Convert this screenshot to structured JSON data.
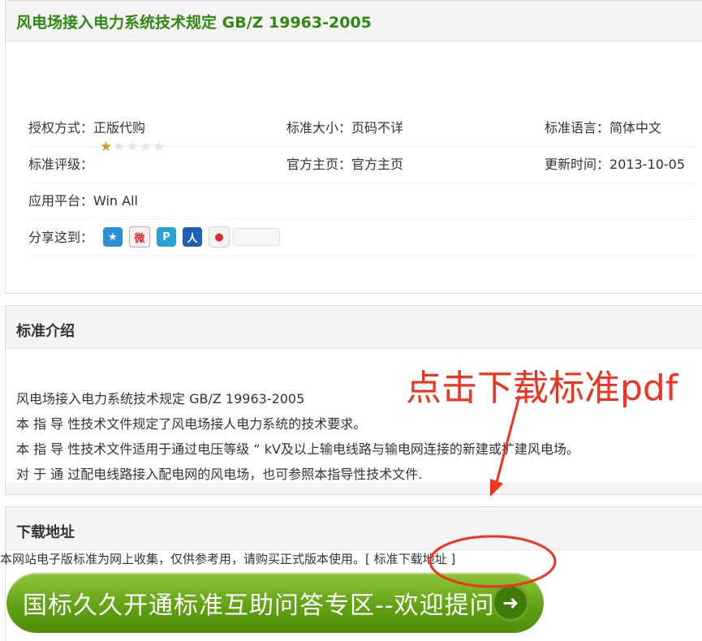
{
  "page_title": "风电场接入电力系统技术规定 GB/Z 19963-2005",
  "info": {
    "auth_label": "授权方式：",
    "auth_value": "正版代购",
    "size_label": "标准大小：",
    "size_value": "页码不详",
    "lang_label": "标准语言：",
    "lang_value": "简体中文",
    "rating_label": "标准评级：",
    "rating_stars": 1,
    "rating_max": 5,
    "homepage_label": "官方主页：",
    "homepage_value": "官方主页",
    "updated_label": "更新时间：",
    "updated_value": "2013-10-05",
    "platform_label": "应用平台：",
    "platform_value": "Win All",
    "share_label": "分享这到：",
    "share_icons": [
      "qzone-icon",
      "weibo-icon",
      "tencent-weibo-icon",
      "renren-icon",
      "kaixin-icon"
    ]
  },
  "intro": {
    "heading": "标准介绍",
    "lines": [
      "风电场接入电力系统技术规定  GB/Z 19963-2005",
      "本 指 导 性技术文件规定了风电场接人电力系统的技术要求。",
      "本 指 导 性技术文件适用于通过电压等级 “ kV及以上输电线路与输电网连接的新建或扩建风电场。",
      "对 于 通 过配电线路接入配电网的风电场，也可参照本指导性技术文件."
    ]
  },
  "download": {
    "heading": "下载地址",
    "notice": "本网站电子版标准为网上收集，仅供参考用，请购买正式版本使用。",
    "link_open": "[ ",
    "link_label": "标准下载地址",
    "link_close": " ]"
  },
  "qa_button": {
    "label": "国标久久开通标准互助问答专区--欢迎提问"
  },
  "annotation": {
    "text": "点击下载标准pdf",
    "color": "#f0321f"
  }
}
